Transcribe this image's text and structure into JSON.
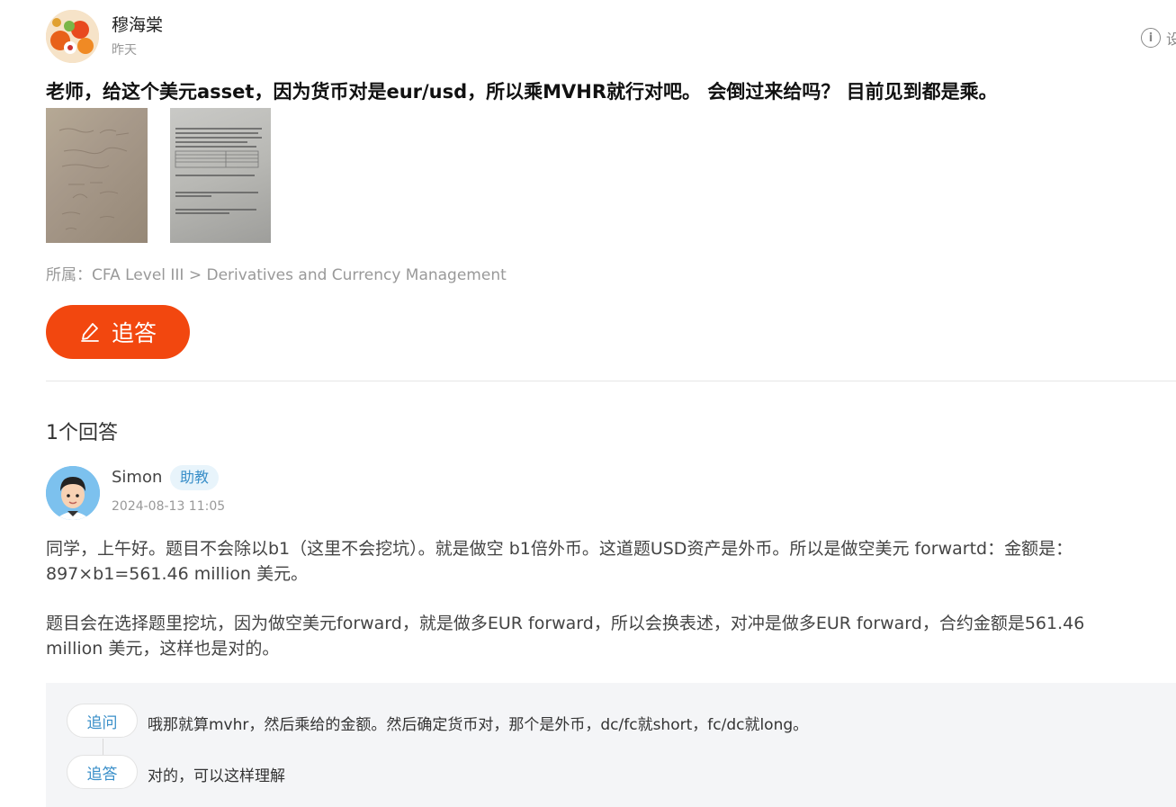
{
  "asker": {
    "name": "穆海棠",
    "time": "昨天"
  },
  "report": {
    "icon": "info-circle-icon",
    "label": "i",
    "text": "设"
  },
  "question": {
    "text": "老师，给这个美元asset，因为货币对是eur/usd，所以乘MVHR就行对吧。 会倒过来给吗？ 目前见到都是乘。",
    "attachments": [
      "handwritten-notes-photo",
      "printed-question-photo"
    ]
  },
  "category": "所属：CFA Level III > Derivatives and Currency Management",
  "followup_button": {
    "label": "追答",
    "icon": "pencil-icon"
  },
  "answers": {
    "count_label": "1个回答"
  },
  "answer": {
    "author": "Simon",
    "role": "助教",
    "time": "2024-08-13 11:05",
    "paragraph1": "同学，上午好。题目不会除以b1（这里不会挖坑）。就是做空 b1倍外币。这道题USD资产是外币。所以是做空美元 forwartd：金额是：897×b1=561.46 million 美元。",
    "paragraph2": "题目会在选择题里挖坑，因为做空美元forward，就是做多EUR forward，所以会换表述，对冲是做多EUR forward，合约金额是561.46 million 美元，这样也是对的。"
  },
  "thread": [
    {
      "tag": "追问",
      "text": "哦那就算mvhr，然后乘给的金额。然后确定货币对，那个是外币，dc/fc就short，fc/dc就long。"
    },
    {
      "tag": "追答",
      "text": "对的，可以这样理解"
    }
  ],
  "colors": {
    "accent": "#f2470f",
    "link_blue": "#3a8fc9",
    "thread_bg": "#f4f5f7"
  }
}
